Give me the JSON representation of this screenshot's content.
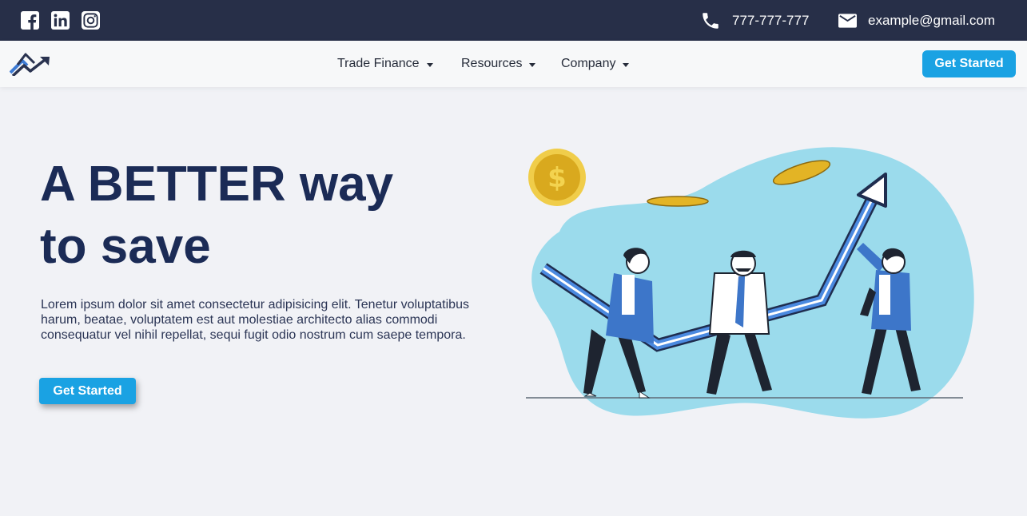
{
  "topbar": {
    "social": [
      {
        "name": "facebook-icon"
      },
      {
        "name": "linkedin-icon"
      },
      {
        "name": "instagram-icon"
      }
    ],
    "phone": "777-777-777",
    "email": "example@gmail.com"
  },
  "nav": {
    "items": [
      {
        "label": "Trade Finance"
      },
      {
        "label": "Resources"
      },
      {
        "label": "Company"
      }
    ],
    "cta": "Get Started"
  },
  "hero": {
    "title_line1": "A BETTER way",
    "title_line2": "to save",
    "text": "Lorem ipsum dolor sit amet consectetur adipisicing elit. Tenetur voluptatibus harum, beatae, voluptatem est aut molestiae architecto alias commodi consequatur vel nihil repellat, sequi fugit odio nostrum cum saepe tempora.",
    "cta": "Get Started"
  },
  "colors": {
    "topbar": "#272f48",
    "accent": "#1aa2e3",
    "heading": "#1b2b56",
    "blob": "#9bdbec"
  }
}
